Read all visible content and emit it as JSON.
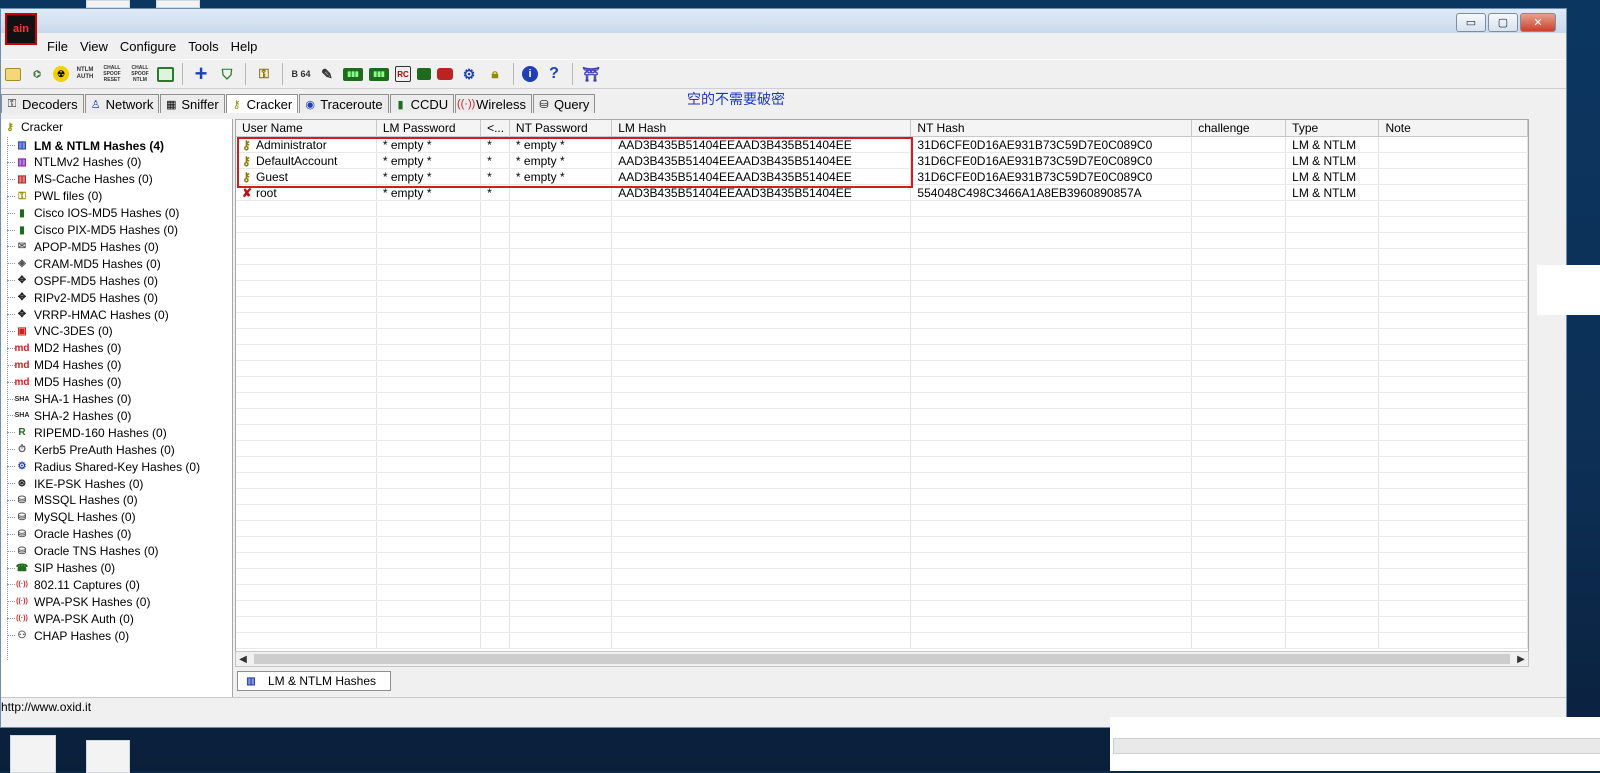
{
  "app": {
    "icon_label": "ain"
  },
  "window_buttons": {
    "minimize": "▭",
    "maximize": "▢",
    "close": "✕"
  },
  "menu": [
    "File",
    "View",
    "Configure",
    "Tools",
    "Help"
  ],
  "toolbar": {
    "icons": [
      "open-icon",
      "network-icon",
      "radiation-icon",
      "ntlm-auth-icon",
      "chall-spoof-reset-icon",
      "chall-spoof-ntlm-icon",
      "monitor-icon",
      "add-icon",
      "remove-icon",
      "decoder-icon",
      "base64-icon",
      "hash-calc-icon",
      "mac-icon",
      "mac2-icon",
      "rc-icon",
      "terminal-icon",
      "db-icon",
      "graph-icon",
      "lock-icon",
      "info-icon",
      "help-icon",
      "exit-icon"
    ],
    "labels": {
      "ntlm_auth": "NTLM AUTH",
      "chall_spoof_reset": "CHALL SPOOF RESET",
      "chall_spoof_ntlm": "CHALL SPOOF NTLM",
      "b64": "B 64"
    }
  },
  "tabs": [
    {
      "label": "Decoders",
      "icon": "decoder-icon"
    },
    {
      "label": "Network",
      "icon": "network-icon"
    },
    {
      "label": "Sniffer",
      "icon": "sniffer-icon"
    },
    {
      "label": "Cracker",
      "icon": "cracker-icon",
      "active": true
    },
    {
      "label": "Traceroute",
      "icon": "traceroute-icon"
    },
    {
      "label": "CCDU",
      "icon": "ccdu-icon"
    },
    {
      "label": "Wireless",
      "icon": "wireless-icon"
    },
    {
      "label": "Query",
      "icon": "query-icon"
    }
  ],
  "annotation": "空的不需要破密",
  "tree": {
    "root": "Cracker",
    "items": [
      "LM & NTLM Hashes (4)",
      "NTLMv2 Hashes (0)",
      "MS-Cache Hashes (0)",
      "PWL files (0)",
      "Cisco IOS-MD5 Hashes (0)",
      "Cisco PIX-MD5 Hashes (0)",
      "APOP-MD5 Hashes (0)",
      "CRAM-MD5 Hashes (0)",
      "OSPF-MD5 Hashes (0)",
      "RIPv2-MD5 Hashes (0)",
      "VRRP-HMAC Hashes (0)",
      "VNC-3DES (0)",
      "MD2 Hashes (0)",
      "MD4 Hashes (0)",
      "MD5 Hashes (0)",
      "SHA-1 Hashes (0)",
      "SHA-2 Hashes (0)",
      "RIPEMD-160 Hashes (0)",
      "Kerb5 PreAuth Hashes (0)",
      "Radius Shared-Key Hashes (0)",
      "IKE-PSK Hashes (0)",
      "MSSQL Hashes (0)",
      "MySQL Hashes (0)",
      "Oracle Hashes (0)",
      "Oracle TNS Hashes (0)",
      "SIP Hashes (0)",
      "802.11 Captures (0)",
      "WPA-PSK Hashes (0)",
      "WPA-PSK Auth (0)",
      "CHAP Hashes (0)"
    ]
  },
  "table": {
    "columns": [
      "User Name",
      "LM Password",
      "<...",
      "NT Password",
      "LM Hash",
      "NT Hash",
      "challenge",
      "Type",
      "Note"
    ],
    "rows": [
      [
        "Administrator",
        "* empty *",
        "*",
        "* empty *",
        "AAD3B435B51404EEAAD3B435B51404EE",
        "31D6CFE0D16AE931B73C59D7E0C089C0",
        "",
        "LM & NTLM",
        ""
      ],
      [
        "DefaultAccount",
        "* empty *",
        "*",
        "* empty *",
        "AAD3B435B51404EEAAD3B435B51404EE",
        "31D6CFE0D16AE931B73C59D7E0C089C0",
        "",
        "LM & NTLM",
        ""
      ],
      [
        "Guest",
        "* empty *",
        "*",
        "* empty *",
        "AAD3B435B51404EEAAD3B435B51404EE",
        "31D6CFE0D16AE931B73C59D7E0C089C0",
        "",
        "LM & NTLM",
        ""
      ],
      [
        "root",
        "* empty *",
        "*",
        "",
        "AAD3B435B51404EEAAD3B435B51404EE",
        "554048C498C3466A1A8EB3960890857A",
        "",
        "LM & NTLM",
        ""
      ]
    ]
  },
  "bottom_tab": "LM & NTLM Hashes",
  "status": "http://www.oxid.it",
  "colors": {
    "highlight_box": "#d31c1c",
    "annotation": "#1a35c8"
  }
}
